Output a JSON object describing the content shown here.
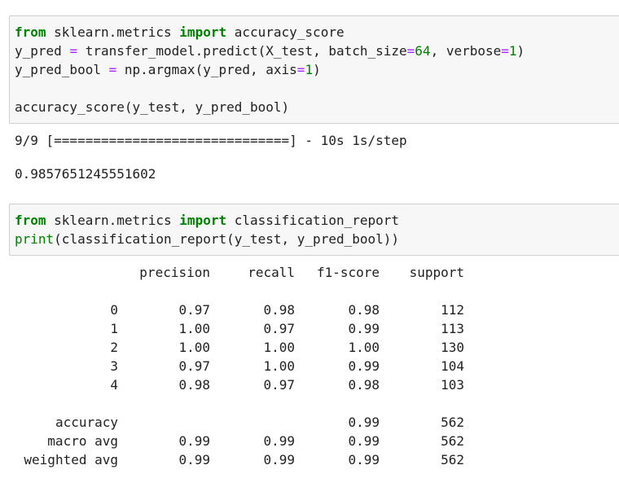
{
  "cell1": {
    "line1": {
      "kw1": "from",
      "mod": " sklearn.metrics ",
      "kw2": "import",
      "name": " accuracy_score"
    },
    "line2": {
      "a": "y_pred ",
      "eq": "=",
      "b": " transfer_model.predict(X_test, batch_size",
      "eq2": "=",
      "n1": "64",
      "c": ", verbose",
      "eq3": "=",
      "n2": "1",
      "d": ")"
    },
    "line3": {
      "a": "y_pred_bool ",
      "eq": "=",
      "b": " np.argmax(y_pred, axis",
      "eq2": "=",
      "n1": "1",
      "c": ")"
    },
    "line5": "accuracy_score(y_test, y_pred_bool)"
  },
  "output1": {
    "progress": "9/9 [==============================] - 10s 1s/step",
    "result": "0.9857651245551602"
  },
  "cell2": {
    "line1": {
      "kw1": "from",
      "mod": " sklearn.metrics ",
      "kw2": "import",
      "name": " classification_report"
    },
    "line2": {
      "fn": "print",
      "rest": "(classification_report(y_test, y_pred_bool))"
    }
  },
  "report": {
    "headers": [
      "precision",
      "recall",
      "f1-score",
      "support"
    ],
    "rows": [
      {
        "label": "0",
        "precision": "0.97",
        "recall": "0.98",
        "f1": "0.98",
        "support": "112"
      },
      {
        "label": "1",
        "precision": "1.00",
        "recall": "0.97",
        "f1": "0.99",
        "support": "113"
      },
      {
        "label": "2",
        "precision": "1.00",
        "recall": "1.00",
        "f1": "1.00",
        "support": "130"
      },
      {
        "label": "3",
        "precision": "0.97",
        "recall": "1.00",
        "f1": "0.99",
        "support": "104"
      },
      {
        "label": "4",
        "precision": "0.98",
        "recall": "0.97",
        "f1": "0.98",
        "support": "103"
      }
    ],
    "summary": [
      {
        "label": "accuracy",
        "precision": "",
        "recall": "",
        "f1": "0.99",
        "support": "562"
      },
      {
        "label": "macro avg",
        "precision": "0.99",
        "recall": "0.99",
        "f1": "0.99",
        "support": "562"
      },
      {
        "label": "weighted avg",
        "precision": "0.99",
        "recall": "0.99",
        "f1": "0.99",
        "support": "562"
      }
    ]
  }
}
